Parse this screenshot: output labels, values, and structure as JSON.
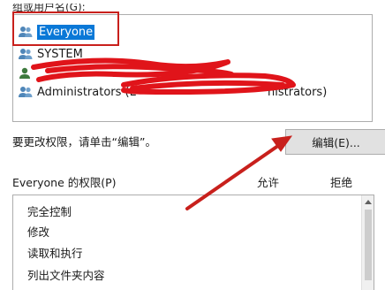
{
  "groups": {
    "label": "组或用户名(G):",
    "users": [
      {
        "name": "Everyone",
        "icon": "users-group-icon",
        "selected": true
      },
      {
        "name": "SYSTEM",
        "icon": "users-group-icon",
        "selected": false
      },
      {
        "name": "",
        "icon": "user-icon",
        "selected": false,
        "redacted": true
      },
      {
        "name": "Administrators (L",
        "suffix": "nistrators)",
        "icon": "users-group-icon",
        "selected": false
      }
    ]
  },
  "hint": "要更改权限，请单击“编辑”。",
  "edit_button": "编辑(E)...",
  "permissions": {
    "label": "Everyone 的权限(P)",
    "allow": "允许",
    "deny": "拒绝",
    "items": [
      "完全控制",
      "修改",
      "读取和执行",
      "列出文件夹内容"
    ]
  },
  "colors": {
    "selection": "#0a78d7",
    "annotation_red": "#c8201c",
    "scribble_red": "#e0141a"
  }
}
